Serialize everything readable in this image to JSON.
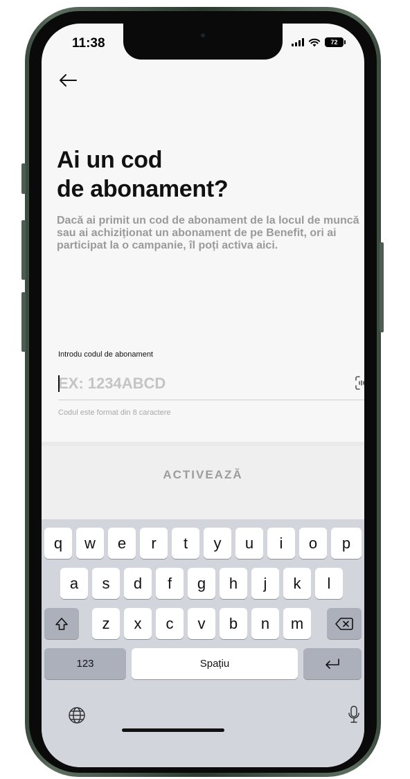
{
  "status_bar": {
    "time": "11:38",
    "battery": "72"
  },
  "header": {
    "back_icon": "arrow-left-icon"
  },
  "title": {
    "line1": "Ai un cod",
    "line2": "de abonament?"
  },
  "description": "Dacă ai primit un cod de abonament de la locul de muncă sau ai achiziționat un abonament de pe Benefit, ori ai participat la o campanie, îl poți activa aici.",
  "code_field": {
    "label": "Introdu codul de abonament",
    "placeholder": "EX: 1234ABCD",
    "value": "",
    "hint": "Codul este format din 8 caractere",
    "scan_icon": "scan-code-icon"
  },
  "activate_button": {
    "label": "ACTIVEAZĂ"
  },
  "keyboard": {
    "row1": [
      "q",
      "w",
      "e",
      "r",
      "t",
      "y",
      "u",
      "i",
      "o",
      "p"
    ],
    "row2": [
      "a",
      "s",
      "d",
      "f",
      "g",
      "h",
      "j",
      "k",
      "l"
    ],
    "row3": [
      "z",
      "x",
      "c",
      "v",
      "b",
      "n",
      "m"
    ],
    "numbers_label": "123",
    "space_label": "Spațiu",
    "shift_icon": "shift-icon",
    "delete_icon": "delete-icon",
    "return_icon": "return-icon",
    "globe_icon": "globe-icon",
    "mic_icon": "microphone-icon"
  },
  "colors": {
    "frame": "#3a4a3e",
    "title": "#111111",
    "muted_text": "#9a9a9a",
    "keyboard_bg": "#d2d5db"
  }
}
